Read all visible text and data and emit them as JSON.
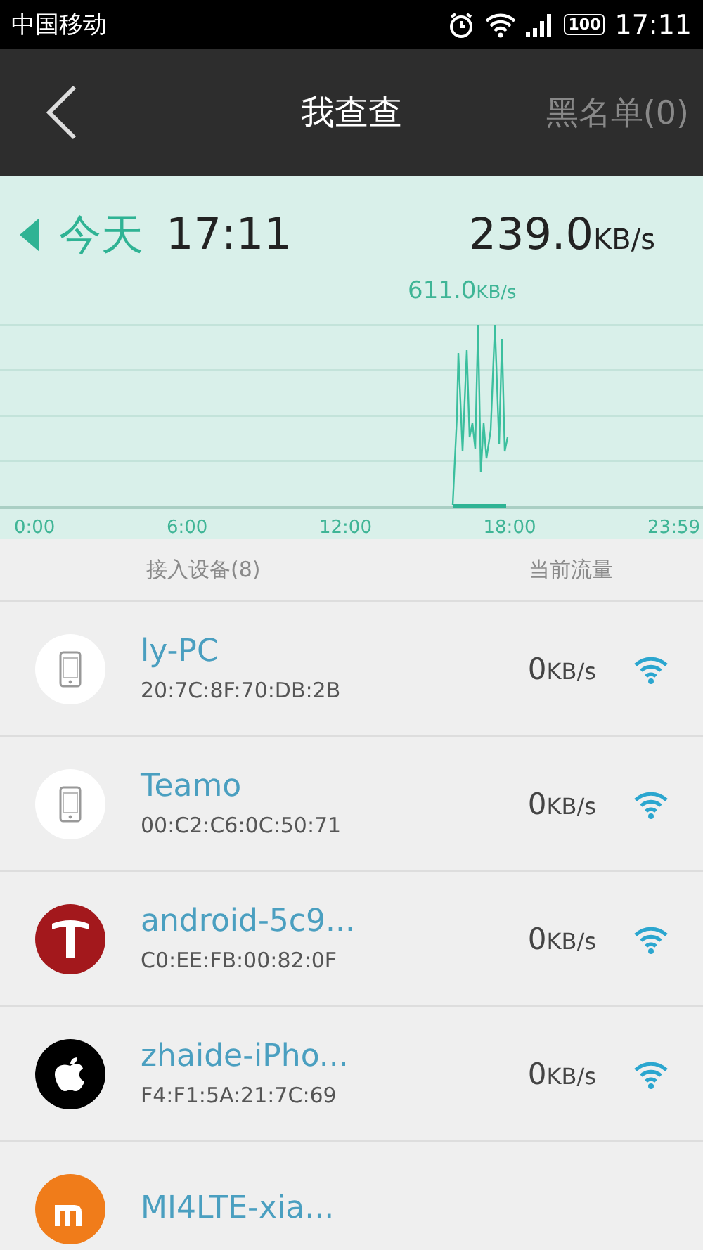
{
  "status_bar": {
    "carrier": "中国移动",
    "battery": "100",
    "time": "17:11"
  },
  "header": {
    "title": "我查查",
    "action": "黑名单(0)"
  },
  "summary": {
    "day": "今天",
    "time": "17:11",
    "speed": "239.0",
    "unit": "KB/s"
  },
  "chart": {
    "peak_value": "611.0",
    "peak_unit": "KB/s",
    "x_labels": [
      "0:00",
      "6:00",
      "12:00",
      "18:00",
      "23:59"
    ]
  },
  "columns": [
    "接入设备(8)",
    "当前流量"
  ],
  "devices": [
    {
      "kind": "phone",
      "name": "ly-PC",
      "mac": "20:7C:8F:70:DB:2B",
      "rate": "0",
      "unit": "KB/s"
    },
    {
      "kind": "phone",
      "name": "Teamo",
      "mac": "00:C2:C6:0C:50:71",
      "rate": "0",
      "unit": "KB/s"
    },
    {
      "kind": "t-logo",
      "name": "android-5c9...",
      "mac": "C0:EE:FB:00:82:0F",
      "rate": "0",
      "unit": "KB/s"
    },
    {
      "kind": "apple",
      "name": "zhaide-iPho...",
      "mac": "F4:F1:5A:21:7C:69",
      "rate": "0",
      "unit": "KB/s"
    },
    {
      "kind": "mi",
      "name": "MI4LTE-xia..."
    }
  ]
}
